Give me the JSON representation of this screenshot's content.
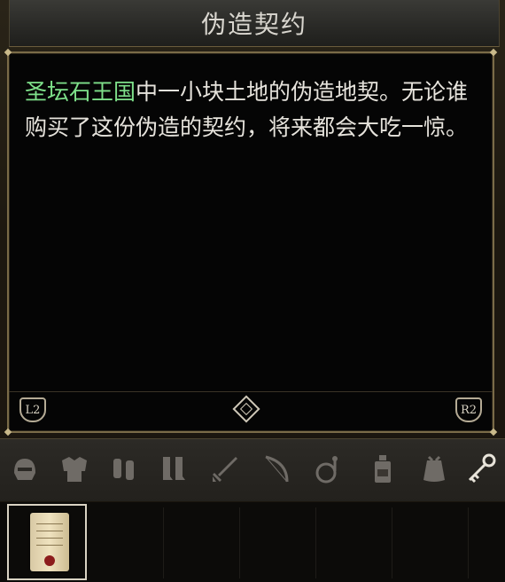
{
  "item": {
    "title": "伪造契约",
    "description_highlight": "圣坛石王国",
    "description_rest": "中一小块土地的伪造地契。无论谁购买了这份伪造的契约，将来都会大吃一惊。"
  },
  "nav": {
    "left_button": "L2",
    "right_button": "R2"
  },
  "categories": [
    {
      "icon": "helmet-icon"
    },
    {
      "icon": "armor-icon"
    },
    {
      "icon": "gauntlets-icon"
    },
    {
      "icon": "boots-icon"
    },
    {
      "icon": "sword-icon"
    },
    {
      "icon": "bow-icon"
    },
    {
      "icon": "ingredients-icon"
    },
    {
      "icon": "potion-icon"
    },
    {
      "icon": "pouch-icon"
    },
    {
      "icon": "keys-icon",
      "active": true
    }
  ],
  "inventory": {
    "selected_item_icon": "scroll-icon"
  },
  "colors": {
    "highlight": "#7ee08a",
    "text": "#e6e3dc",
    "border": "#7a6b48"
  }
}
